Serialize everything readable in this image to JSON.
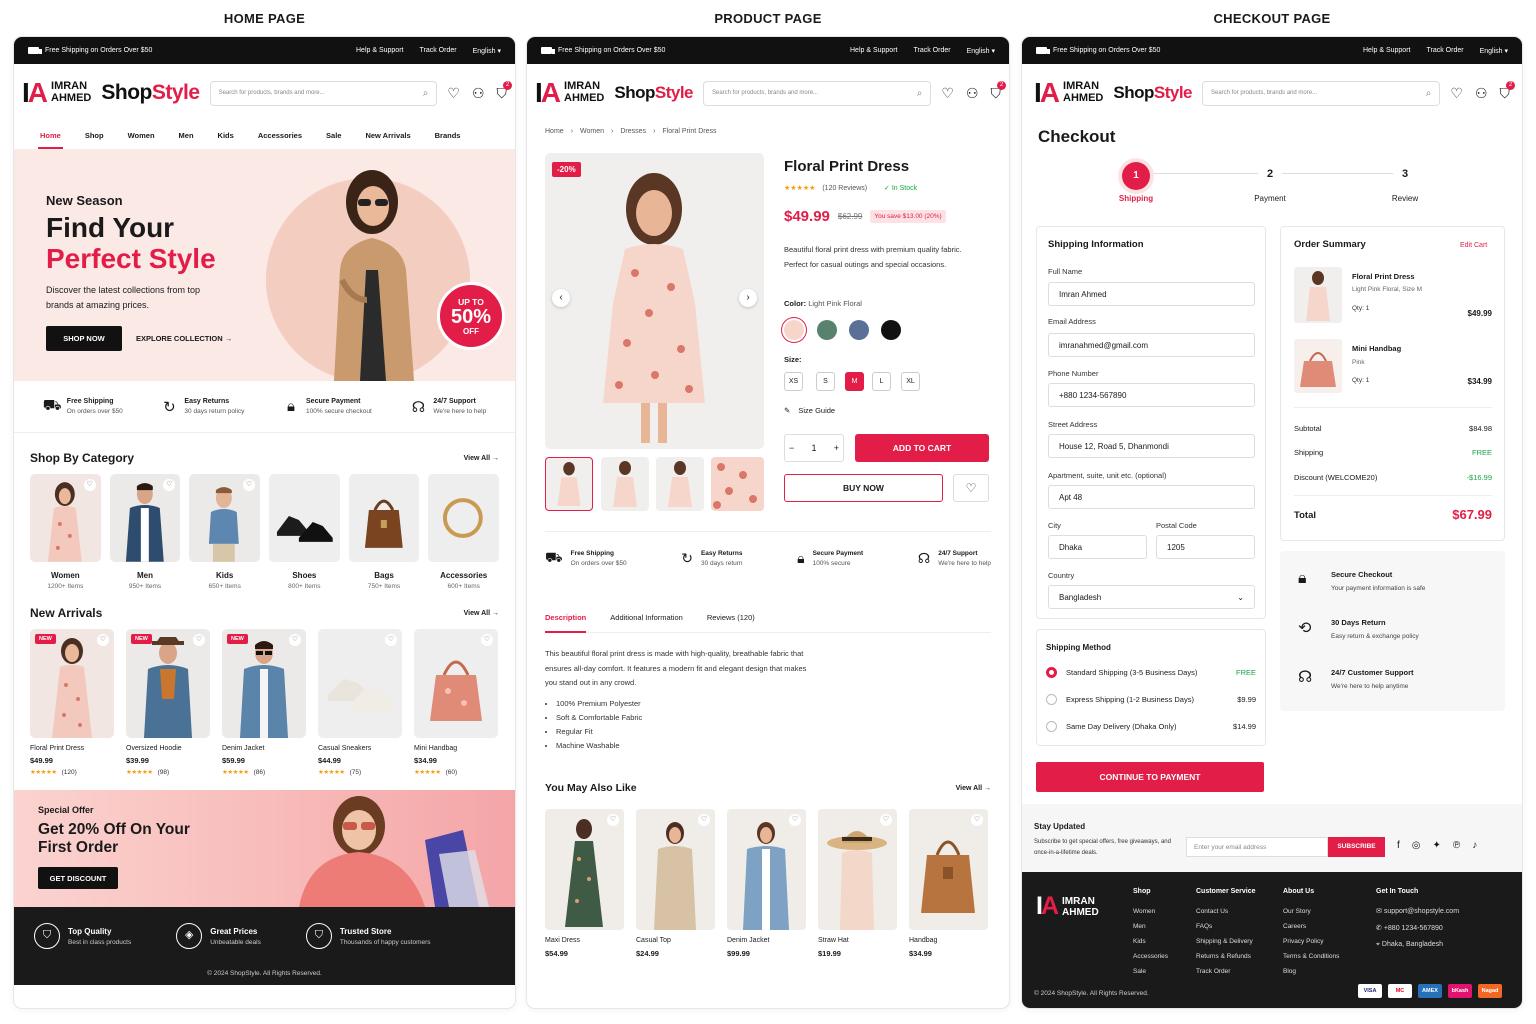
{
  "columns": {
    "home": "HOME PAGE",
    "product": "PRODUCT PAGE",
    "checkout": "CHECKOUT PAGE"
  },
  "topbar": {
    "shipping": "Free Shipping on Orders Over $50",
    "help": "Help & Support",
    "track": "Track Order",
    "lang": "English"
  },
  "brand": {
    "logo_line1": "IMRAN",
    "logo_line2": "AHMED",
    "name_a": "Shop",
    "name_b": "Style"
  },
  "search": {
    "placeholder": "Search for products, brands and more..."
  },
  "cart_count": "2",
  "nav": [
    "Home",
    "Shop",
    "Women",
    "Men",
    "Kids",
    "Accessories",
    "Sale",
    "New Arrivals",
    "Brands"
  ],
  "hero": {
    "kicker": "New Season",
    "title_1": "Find Your",
    "title_2": "Perfect Style",
    "desc": "Discover the latest collections from top brands at amazing prices.",
    "cta": "SHOP NOW",
    "link": "EXPLORE COLLECTION",
    "sale_a": "UP TO",
    "sale_b": "50%",
    "sale_c": "OFF"
  },
  "features": [
    {
      "title": "Free Shipping",
      "sub": "On orders over $50"
    },
    {
      "title": "Easy Returns",
      "sub": "30 days return policy"
    },
    {
      "title": "Secure Payment",
      "sub": "100% secure checkout"
    },
    {
      "title": "24/7 Support",
      "sub": "We're here to help"
    }
  ],
  "categories_title": "Shop By Category",
  "view_all": "View All",
  "categories": [
    {
      "name": "Women",
      "count": "1200+ Items"
    },
    {
      "name": "Men",
      "count": "950+ Items"
    },
    {
      "name": "Kids",
      "count": "650+ Items"
    },
    {
      "name": "Shoes",
      "count": "800+ Items"
    },
    {
      "name": "Bags",
      "count": "750+ Items"
    },
    {
      "name": "Accessories",
      "count": "600+ Items"
    }
  ],
  "new_arrivals_title": "New Arrivals",
  "new_tag": "NEW",
  "new_arrivals": [
    {
      "name": "Floral Print Dress",
      "price": "$49.99",
      "reviews": "(120)"
    },
    {
      "name": "Oversized Hoodie",
      "price": "$39.99",
      "reviews": "(98)"
    },
    {
      "name": "Denim Jacket",
      "price": "$59.99",
      "reviews": "(86)"
    },
    {
      "name": "Casual Sneakers",
      "price": "$44.99",
      "reviews": "(75)"
    },
    {
      "name": "Mini Handbag",
      "price": "$34.99",
      "reviews": "(60)"
    }
  ],
  "offer": {
    "kicker": "Special Offer",
    "title_1": "Get 20% Off On Your",
    "title_2": "First Order",
    "cta": "GET DISCOUNT"
  },
  "trust": [
    {
      "title": "Top Quality",
      "sub": "Best in class products"
    },
    {
      "title": "Great Prices",
      "sub": "Unbeatable deals"
    },
    {
      "title": "Trusted Store",
      "sub": "Thousands of happy customers"
    }
  ],
  "copyright": "© 2024 ShopStyle. All Rights Reserved.",
  "product": {
    "crumbs": [
      "Home",
      "Women",
      "Dresses",
      "Floral Print Dress"
    ],
    "discount": "-20%",
    "title": "Floral Print Dress",
    "reviews": "(120 Reviews)",
    "stock": "In Stock",
    "price": "$49.99",
    "old_price": "$62.99",
    "save": "You save $13.00 (20%)",
    "desc": "Beautiful floral print dress with premium quality fabric. Perfect for casual outings and special occasions.",
    "color_label": "Color:",
    "color_value": "Light Pink Floral",
    "size_label": "Size:",
    "sizes": [
      "XS",
      "S",
      "M",
      "L",
      "XL"
    ],
    "selected_size": "M",
    "size_guide": "Size Guide",
    "qty": "1",
    "add_to_cart": "ADD TO CART",
    "buy_now": "BUY NOW",
    "features": [
      {
        "title": "Free Shipping",
        "sub": "On orders over $50"
      },
      {
        "title": "Easy Returns",
        "sub": "30 days return"
      },
      {
        "title": "Secure Payment",
        "sub": "100% secure"
      },
      {
        "title": "24/7 Support",
        "sub": "We're here to help"
      }
    ],
    "tabs": [
      "Description",
      "Additional Information",
      "Reviews (120)"
    ],
    "long_desc": "This beautiful floral print dress is made with high-quality, breathable fabric that ensures all-day comfort. It features a modern fit and elegant design that makes you stand out in any crowd.",
    "bullets": [
      "100% Premium Polyester",
      "Soft & Comfortable Fabric",
      "Regular Fit",
      "Machine Washable"
    ],
    "also_title": "You May Also Like",
    "also": [
      {
        "name": "Maxi Dress",
        "price": "$54.99"
      },
      {
        "name": "Casual Top",
        "price": "$24.99"
      },
      {
        "name": "Denim Jacket",
        "price": "$99.99"
      },
      {
        "name": "Straw Hat",
        "price": "$19.99"
      },
      {
        "name": "Handbag",
        "price": "$34.99"
      }
    ]
  },
  "checkout": {
    "title": "Checkout",
    "steps": [
      {
        "n": "1",
        "label": "Shipping"
      },
      {
        "n": "2",
        "label": "Payment"
      },
      {
        "n": "3",
        "label": "Review"
      }
    ],
    "ship_info": "Shipping Information",
    "fields": {
      "full_name": {
        "label": "Full Name",
        "value": "Imran Ahmed"
      },
      "email": {
        "label": "Email Address",
        "value": "imranahmed@gmail.com"
      },
      "phone": {
        "label": "Phone Number",
        "value": "+880 1234-567890"
      },
      "street": {
        "label": "Street Address",
        "value": "House 12, Road 5, Dhanmondi"
      },
      "apt": {
        "label": "Apartment, suite, unit etc. (optional)",
        "value": "Apt 48"
      },
      "city": {
        "label": "City",
        "value": "Dhaka"
      },
      "postal": {
        "label": "Postal Code",
        "value": "1205"
      },
      "country": {
        "label": "Country",
        "value": "Bangladesh"
      }
    },
    "method_title": "Shipping Method",
    "methods": [
      {
        "name": "Standard Shipping (3-5 Business Days)",
        "price": "FREE"
      },
      {
        "name": "Express Shipping (1-2 Business Days)",
        "price": "$9.99"
      },
      {
        "name": "Same Day Delivery (Dhaka Only)",
        "price": "$14.99"
      }
    ],
    "continue": "CONTINUE TO PAYMENT",
    "summary_title": "Order Summary",
    "edit_cart": "Edit Cart",
    "items": [
      {
        "name": "Floral Print Dress",
        "variant": "Light Pink Floral, Size M",
        "qty": "Qty: 1",
        "price": "$49.99"
      },
      {
        "name": "Mini Handbag",
        "variant": "Pink",
        "qty": "Qty: 1",
        "price": "$34.99"
      }
    ],
    "subtotal_label": "Subtotal",
    "subtotal": "$84.98",
    "shipping_label": "Shipping",
    "shipping": "FREE",
    "discount_label": "Discount (WELCOME20)",
    "discount": "-$16.99",
    "total_label": "Total",
    "total": "$67.99",
    "assure": [
      {
        "title": "Secure Checkout",
        "sub": "Your payment information is safe"
      },
      {
        "title": "30 Days Return",
        "sub": "Easy return & exchange policy"
      },
      {
        "title": "24/7 Customer Support",
        "sub": "We're here to help anytime"
      }
    ],
    "newsletter": {
      "title": "Stay Updated",
      "sub": "Subscribe to get special offers, free giveaways, and once-in-a-lifetime deals.",
      "placeholder": "Enter your email address",
      "btn": "SUBSCRIBE"
    },
    "footer": {
      "shop_title": "Shop",
      "shop": [
        "Women",
        "Men",
        "Kids",
        "Accessories",
        "Sale"
      ],
      "cs_title": "Customer Service",
      "cs": [
        "Contact Us",
        "FAQs",
        "Shipping & Delivery",
        "Returns & Refunds",
        "Track Order"
      ],
      "about_title": "About Us",
      "about": [
        "Our Story",
        "Careers",
        "Privacy Policy",
        "Terms & Conditions",
        "Blog"
      ],
      "contact_title": "Get In Touch",
      "email": "support@shopstyle.com",
      "phone": "+880 1234-567890",
      "address": "Dhaka, Bangladesh",
      "payments": [
        "VISA",
        "MC",
        "AMEX",
        "bKash",
        "Nagad"
      ]
    }
  }
}
